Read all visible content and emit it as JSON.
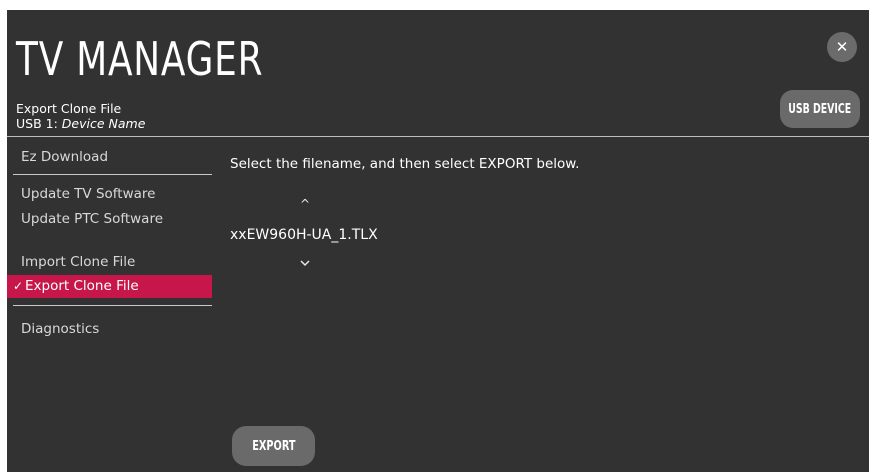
{
  "header": {
    "title": "TV MANAGER",
    "section": "Export Clone File",
    "device_prefix": "USB 1:",
    "device_name": "Device Name",
    "close_label": "✕",
    "usb_button_label": "USB DEVICE"
  },
  "nav": {
    "items": [
      {
        "label": "Ez Download"
      },
      {
        "label": "Update TV Software"
      },
      {
        "label": "Update PTC Software"
      },
      {
        "label": "Import Clone File"
      },
      {
        "label": "Export Clone File",
        "selected": true,
        "check": "✓"
      },
      {
        "label": "Diagnostics"
      }
    ]
  },
  "main": {
    "instruction": "Select the filename, and then select EXPORT below.",
    "up_arrow": "^",
    "filename": "xxEW960H-UA_1.TLX",
    "down_arrow": "v",
    "export_label": "EXPORT"
  },
  "colors": {
    "background": "#333232",
    "accent": "#c6164a",
    "button": "#6a6a6a"
  }
}
